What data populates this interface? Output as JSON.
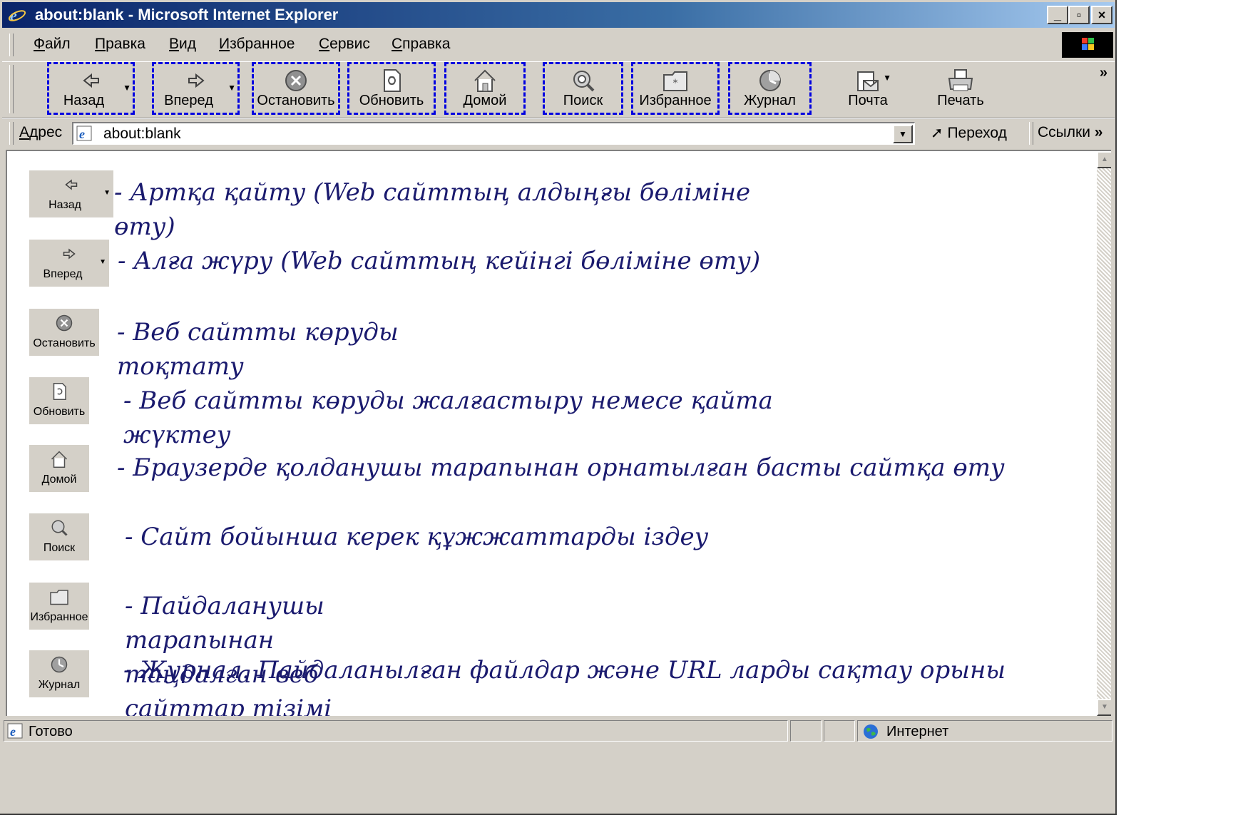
{
  "window": {
    "title": "about:blank - Microsoft Internet Explorer",
    "controls": {
      "minimize": "_",
      "maximize": "▫",
      "close": "×"
    }
  },
  "menu": [
    "Файл",
    "Правка",
    "Вид",
    "Избранное",
    "Сервис",
    "Справка"
  ],
  "toolbar": {
    "buttons": [
      {
        "label": "Назад",
        "icon": "back-arrow-icon",
        "has_dropdown": true,
        "highlighted": true
      },
      {
        "label": "Вперед",
        "icon": "forward-arrow-icon",
        "has_dropdown": true,
        "highlighted": true
      },
      {
        "label": "Остановить",
        "icon": "stop-icon",
        "highlighted": true
      },
      {
        "label": "Обновить",
        "icon": "refresh-icon",
        "highlighted": true
      },
      {
        "label": "Домой",
        "icon": "home-icon",
        "highlighted": true
      },
      {
        "label": "Поиск",
        "icon": "search-icon",
        "highlighted": true
      },
      {
        "label": "Избранное",
        "icon": "favorites-icon",
        "highlighted": true
      },
      {
        "label": "Журнал",
        "icon": "history-icon",
        "highlighted": true
      },
      {
        "label": "Почта",
        "icon": "mail-icon",
        "has_dropdown": true,
        "highlighted": false
      },
      {
        "label": "Печать",
        "icon": "print-icon",
        "highlighted": false
      }
    ],
    "overflow": "»"
  },
  "address": {
    "label": "Адрес",
    "value": "about:blank",
    "go": "Переход",
    "links": "Ссылки"
  },
  "content": {
    "items": [
      {
        "button": "Назад",
        "text": "- Артқа қайту (Web сайттың алдыңғы бөліміне өту)"
      },
      {
        "button": "Вперед",
        "text": "- Алға жүру (Web сайттың кейінгі бөліміне өту)"
      },
      {
        "button": "Остановить",
        "text": "- Веб сайтты көруды тоқтату"
      },
      {
        "button": "Обновить",
        "text": "- Веб сайтты көруды жалғастыру немесе қайта жүктеу"
      },
      {
        "button": "Домой",
        "text": "- Браузерде қолданушы тарапынан орнатылған басты сайтқа өту"
      },
      {
        "button": "Поиск",
        "text": "- Сайт бойынша керек құжжаттарды іздеу"
      },
      {
        "button": "Избранное",
        "text": "- Пайдаланушы тарапынан таңдалған веб сайттар тізімі"
      },
      {
        "button": "Журнал",
        "text": "- Журнал. Пайдаланылған файлдар және URL ларды сақтау орыны"
      }
    ]
  },
  "status": {
    "text": "Готово",
    "zone": "Интернет"
  },
  "colors": {
    "highlight_border": "#0000e0",
    "description_text": "#1a1a6e",
    "title_gradient_start": "#0a246a"
  }
}
